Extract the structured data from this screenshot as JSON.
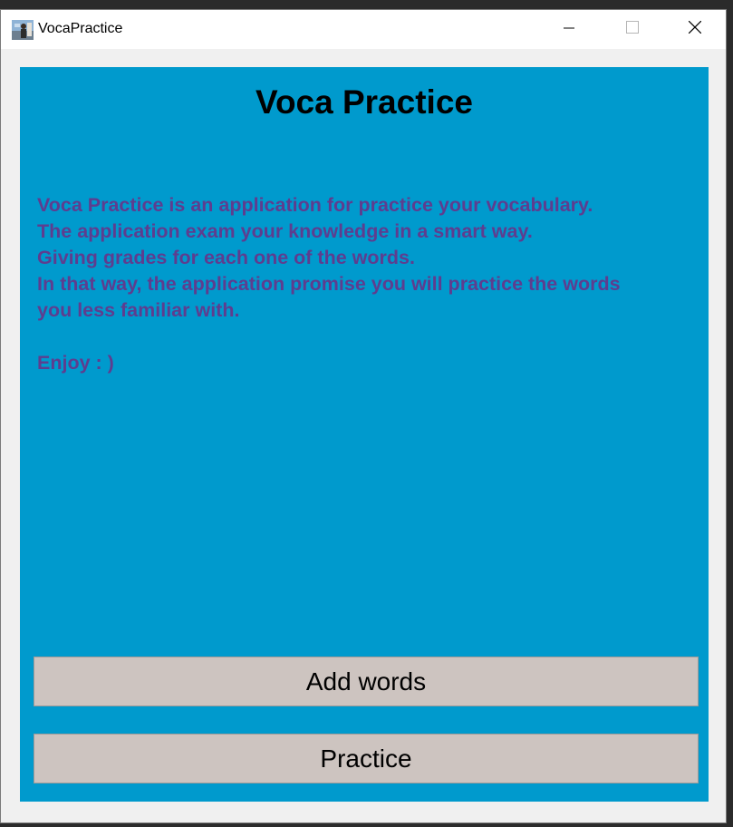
{
  "window": {
    "title": "VocaPractice",
    "app_icon": "app-photo-icon",
    "controls": {
      "minimize_icon": "minimize-icon",
      "maximize_icon": "maximize-icon",
      "close_icon": "close-icon"
    }
  },
  "main": {
    "heading": "Voca Practice",
    "description_lines": [
      "Voca Practice is an application for practice your vocabulary.",
      "The application exam your knowledge in a smart way.",
      "Giving grades for each one of the words.",
      "In that way, the application promise you will practice the words",
      "you less familiar with."
    ],
    "closing_line": "Enjoy : )",
    "buttons": {
      "add_words_label": "Add words",
      "practice_label": "Practice"
    }
  },
  "colors": {
    "panel_background": "#009acd",
    "description_text": "#5e3d8f",
    "button_background": "#cdc4c0"
  }
}
